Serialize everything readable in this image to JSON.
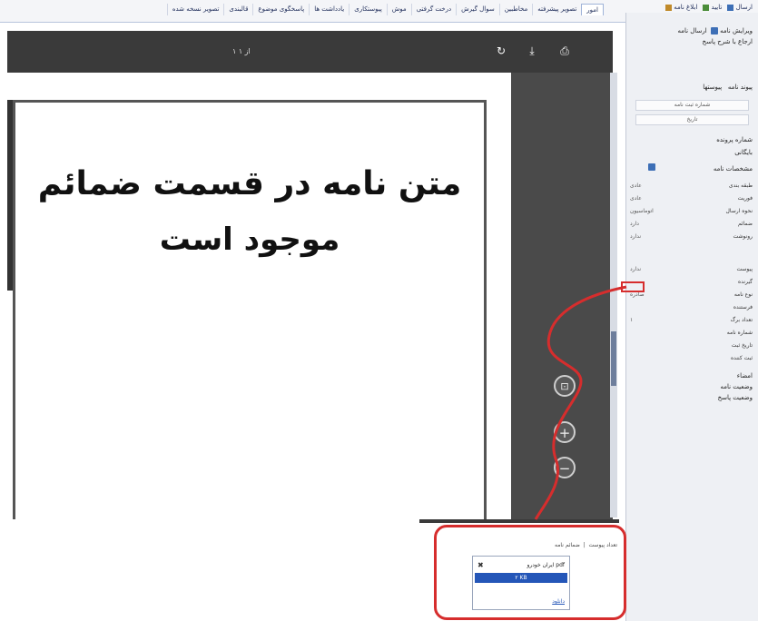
{
  "tabs": [
    "امور",
    "تصویر پیشرفته",
    "مخاطبین",
    "سوال گیرش",
    "درخت گرفتی",
    "موش",
    "پیوستکاری",
    "یادداشت ها",
    "پاسخگوی موضوع",
    "قالبندی",
    "تصویر نسخه شده"
  ],
  "top_right_buttons": [
    "ارسال",
    "تایید",
    "ابلاغ نامه"
  ],
  "panel": {
    "line1": "ویرایش نامه",
    "line1b": "ارسال نامه",
    "line2": "ارجاع با شرح",
    "line2b": "پاسخ",
    "tabs_label": "پیوند نامه",
    "tabs_label2": "پیوستها",
    "box1": "شماره ثبت نامه",
    "box2": "تاریخ",
    "subject_label": "شماره پرونده",
    "subject_val": "بایگانی",
    "heading": "مشخصات نامه",
    "rows": [
      {
        "label": "طبقه بندی",
        "val": "عادی"
      },
      {
        "label": "فوریت",
        "val": "عادی"
      },
      {
        "label": "نحوه ارسال",
        "val": "اتوماسیون"
      },
      {
        "label": "ضمائم",
        "val": "دارد"
      },
      {
        "label": "رونوشت",
        "val": "ندارد"
      },
      {
        "label": "پیوست",
        "val": "ندارد"
      },
      {
        "label": "گیرنده",
        "val": ""
      },
      {
        "label": "نوع نامه",
        "val": "صادره"
      },
      {
        "label": "فرستنده",
        "val": ""
      },
      {
        "label": "تعداد برگ",
        "val": "۱"
      },
      {
        "label": "شماره نامه",
        "val": ""
      },
      {
        "label": "تاریخ ثبت",
        "val": ""
      },
      {
        "label": "ثبت کننده",
        "val": ""
      }
    ],
    "bottom1": "امضاء",
    "bottom2": "وضعیت نامه",
    "bottom3": "وضعیت پاسخ"
  },
  "viewer": {
    "page_indicator": "۱ از ۱",
    "line1": "متن نامه در قسمت ضمائم",
    "line2": "موجود است",
    "zoom_in": "+",
    "zoom_out": "−",
    "fit": "⊡"
  },
  "bottom": {
    "label_left": "ضمائم نامه",
    "label_right": "تعداد پیوست",
    "popup_item1": "ایران خودرو pdf",
    "popup_item2": "۲ KB",
    "popup_link": "دانلود"
  }
}
